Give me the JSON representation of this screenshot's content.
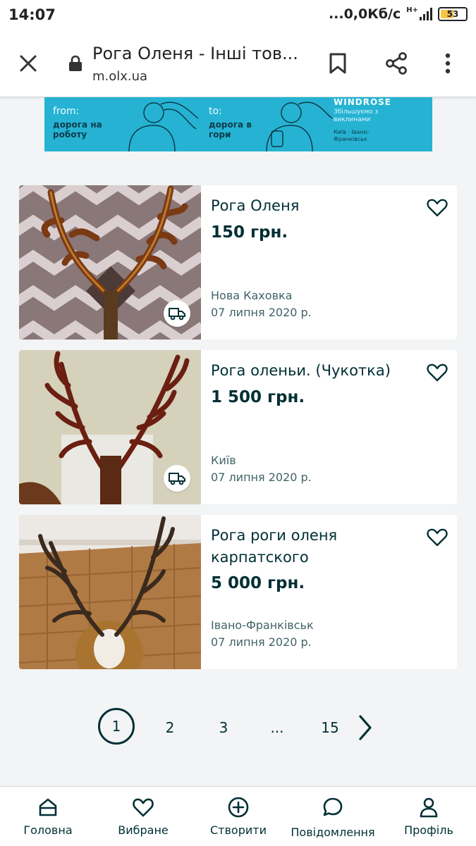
{
  "status_bar": {
    "time": "14:07",
    "network": "...0,0Кб/с",
    "network_type": "H+",
    "battery": "53"
  },
  "browser": {
    "title": "Рога Оленя - Інші тов...",
    "url": "m.olx.ua"
  },
  "banner": {
    "from_label": "from:",
    "from_text": "дорога на роботу",
    "to_label": "to:",
    "to_text": "дорога в гори",
    "brand": "WINDROSE",
    "tagline": "Збільшуємо з виклинами",
    "city": "Київ · Івано-Франківськ"
  },
  "listings": [
    {
      "title": "Рога Оленя",
      "price": "150 грн.",
      "city": "Нова Каховка",
      "date": "07 липня 2020 р.",
      "delivery": true
    },
    {
      "title": "Рога оленьи. (Чукотка)",
      "price": "1 500 грн.",
      "city": "Київ",
      "date": "07 липня 2020 р.",
      "delivery": true
    },
    {
      "title": "Рога роги оленя карпатского",
      "price": "5 000 грн.",
      "city": "Івано-Франківськ",
      "date": "07 липня 2020 р.",
      "delivery": false
    }
  ],
  "pagination": {
    "pages": [
      "1",
      "2",
      "3",
      "...",
      "15"
    ],
    "current": "1"
  },
  "bottom_nav": [
    {
      "label": "Головна",
      "icon": "home-icon"
    },
    {
      "label": "Вибране",
      "icon": "heart-icon"
    },
    {
      "label": "Створити",
      "icon": "plus-circle-icon"
    },
    {
      "label": "Повідомлення",
      "icon": "chat-icon"
    },
    {
      "label": "Профіль",
      "icon": "user-icon"
    }
  ],
  "colors": {
    "primary": "#002f34",
    "background": "#f2f4f5",
    "banner": "#26b3d3",
    "secondary_text": "#406367"
  }
}
